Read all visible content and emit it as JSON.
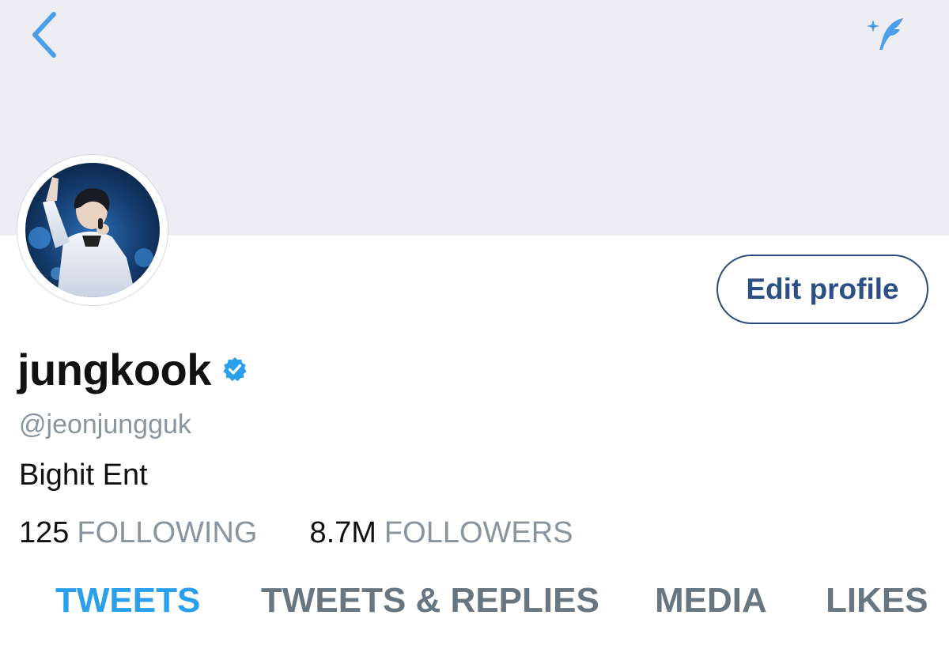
{
  "header": {
    "back_icon": "chevron-left-icon",
    "compose_icon": "feather-sparkle-icon",
    "accent_color": "#4a9fe8",
    "banner_color": "#eeedf3"
  },
  "profile": {
    "display_name": "jungkook",
    "verified": true,
    "handle": "@jeonjungguk",
    "bio": "Bighit Ent",
    "edit_button_label": "Edit profile",
    "following_count": "125",
    "following_label": "FOLLOWING",
    "followers_count": "8.7M",
    "followers_label": "FOLLOWERS"
  },
  "tabs": [
    {
      "label": "TWEETS",
      "active": true
    },
    {
      "label": "TWEETS & REPLIES",
      "active": false
    },
    {
      "label": "MEDIA",
      "active": false
    },
    {
      "label": "LIKES",
      "active": false
    }
  ]
}
